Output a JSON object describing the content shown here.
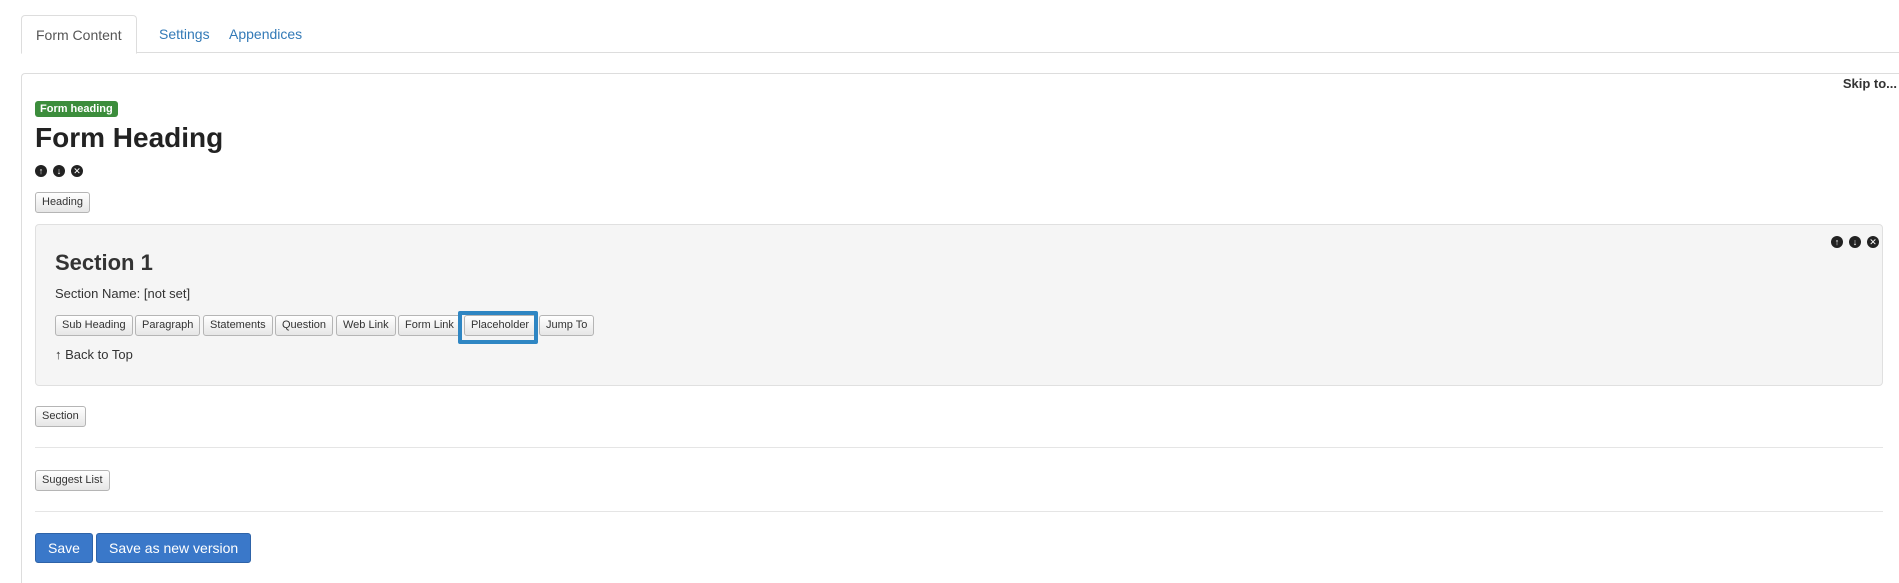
{
  "tabs": [
    {
      "label": "Form Content",
      "active": true
    },
    {
      "label": "Settings",
      "active": false
    },
    {
      "label": "Appendices",
      "active": false
    }
  ],
  "skip_to": "Skip to...",
  "form": {
    "badge": "Form heading",
    "title": "Form Heading",
    "heading_button": "Heading"
  },
  "section": {
    "title": "Section 1",
    "name_line": "Section Name: [not set]",
    "buttons": [
      "Sub Heading",
      "Paragraph",
      "Statements",
      "Question",
      "Web Link",
      "Form Link",
      "Placeholder",
      "Jump To"
    ],
    "highlighted_button": "Placeholder",
    "back_to_top": "Back to Top"
  },
  "section_button": "Section",
  "suggest_list_button": "Suggest List",
  "actions": {
    "save": "Save",
    "save_new_version": "Save as new version"
  },
  "colors": {
    "link": "#337ab7",
    "badge": "#3c8d3c",
    "primary": "#3a78c9",
    "highlight": "#2f86c3"
  }
}
